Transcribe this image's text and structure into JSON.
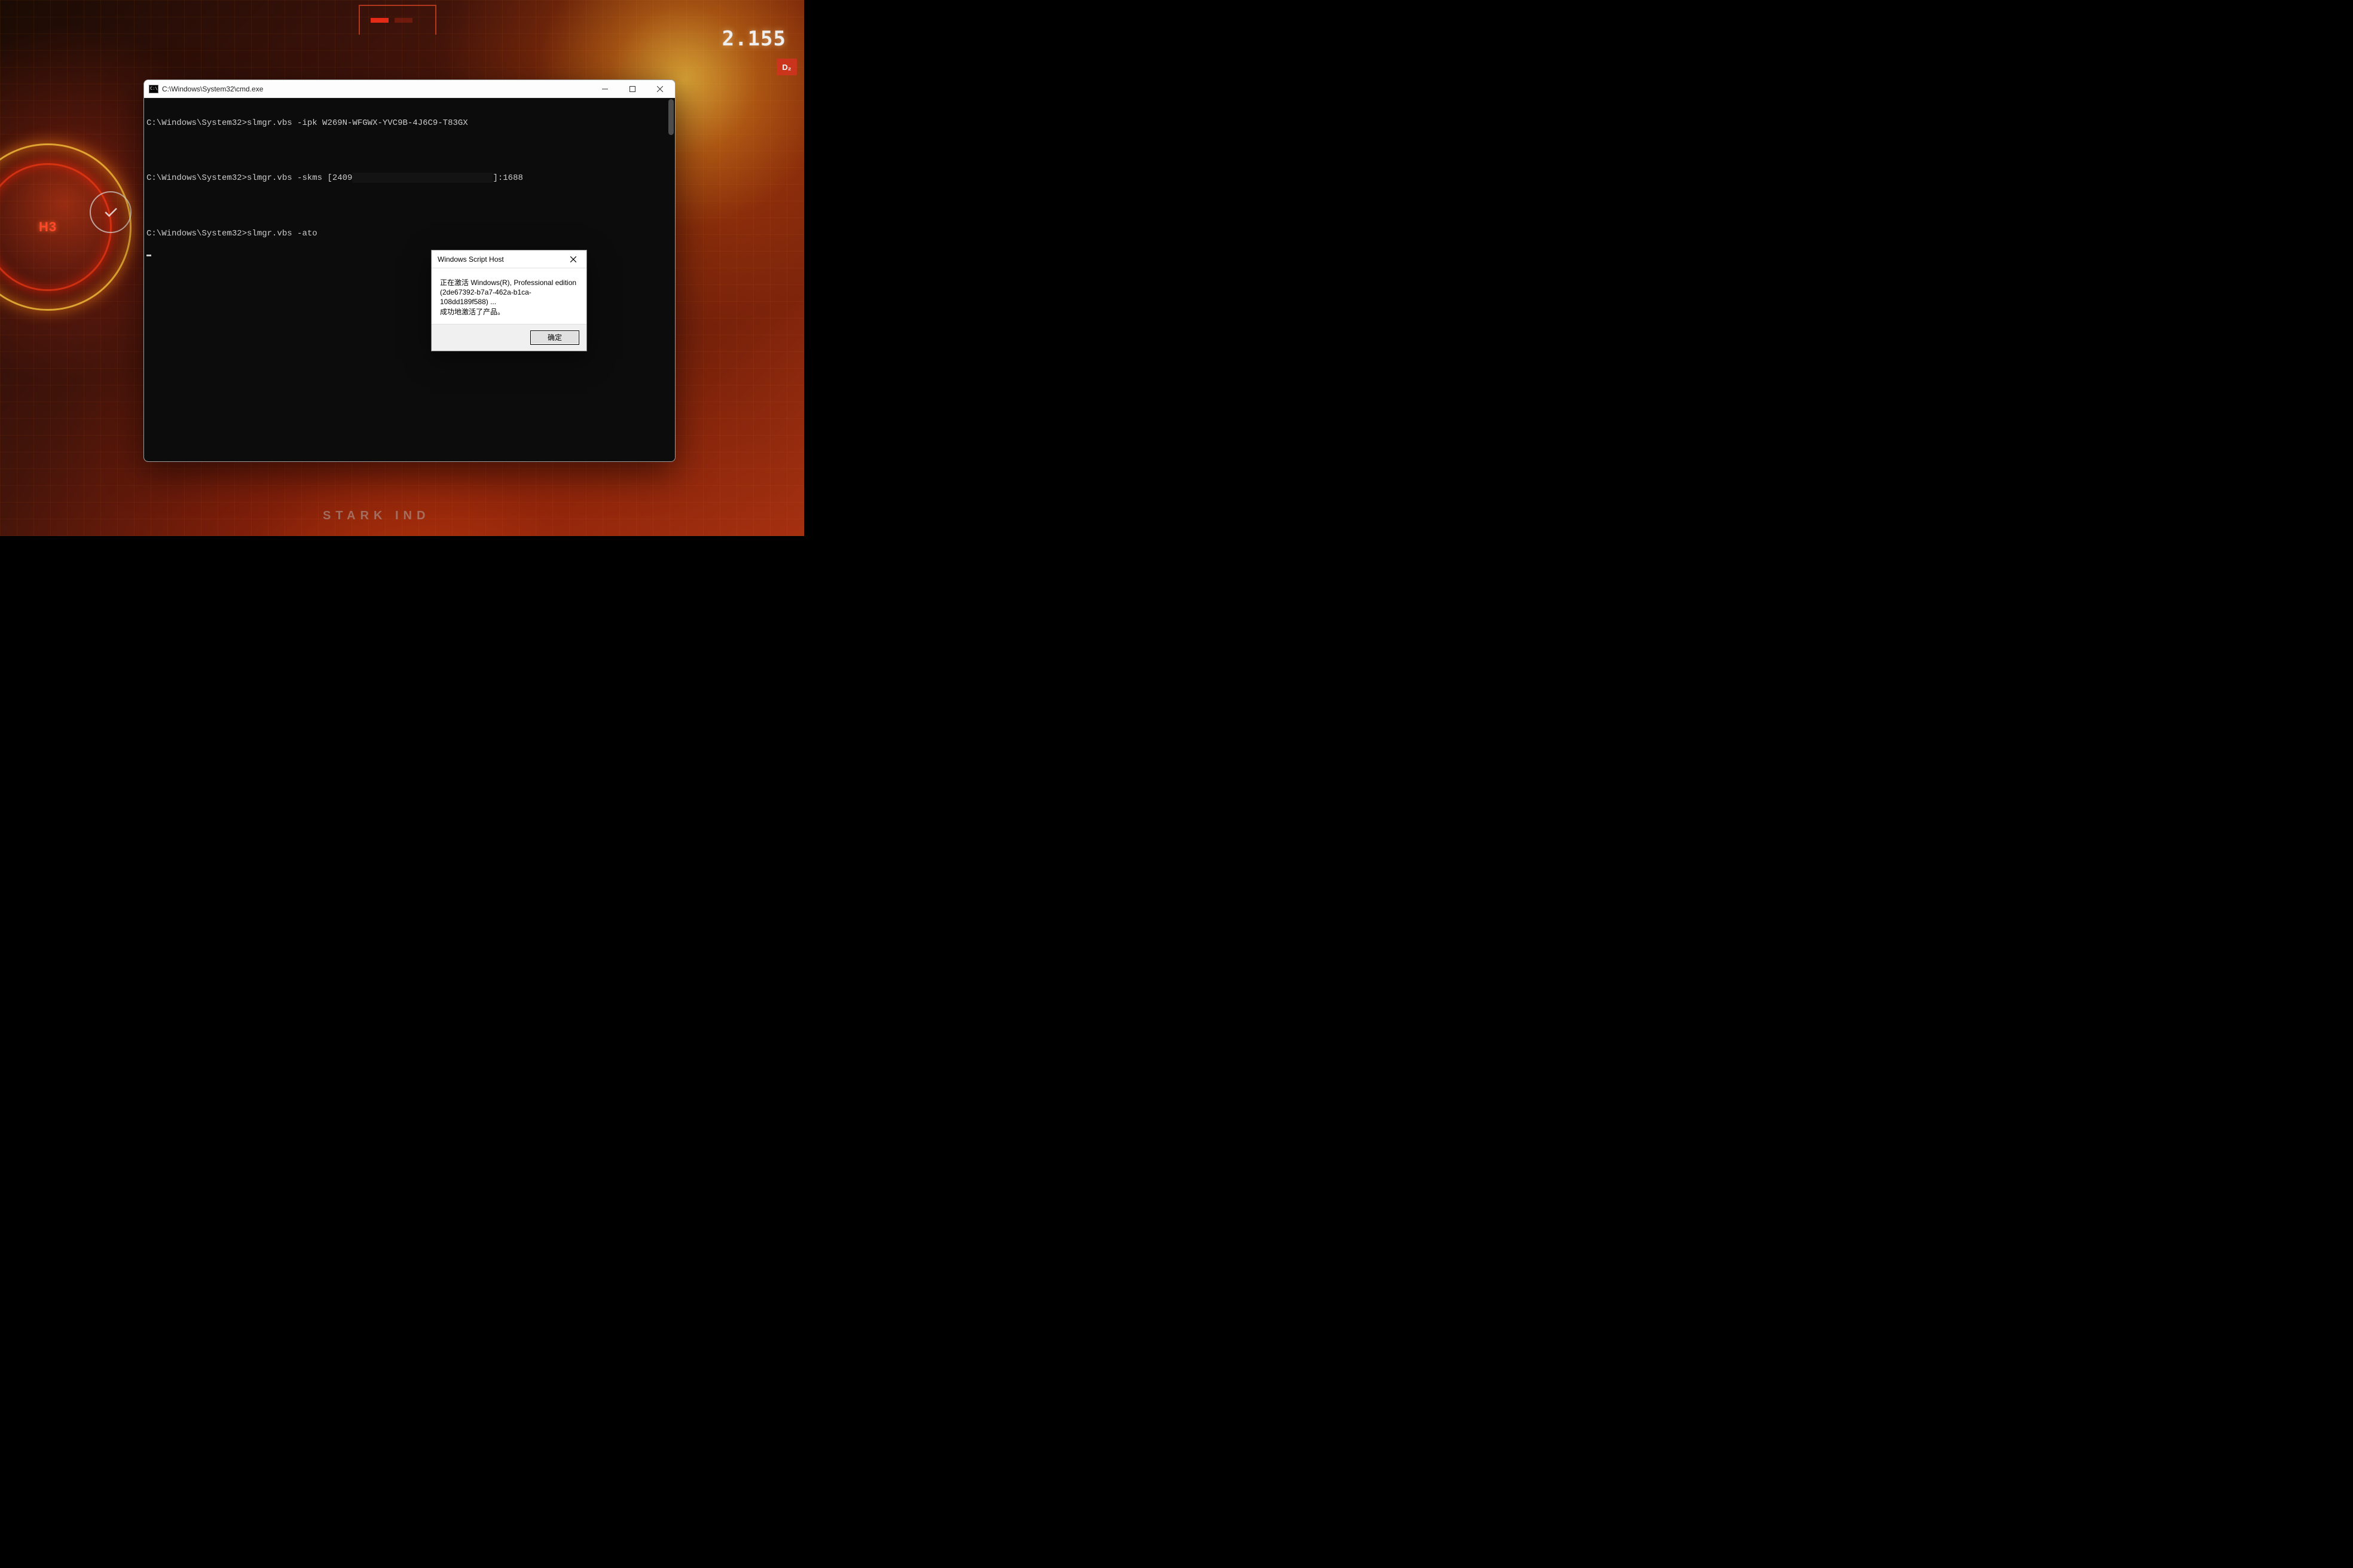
{
  "wallpaper": {
    "ring_label": "H3",
    "meter_value": "2.155",
    "badge": "D₂",
    "brand_hint": "STARK IND"
  },
  "cmd": {
    "title": "C:\\Windows\\System32\\cmd.exe",
    "prompt": "C:\\Windows\\System32>",
    "lines": {
      "l1_cmd": "slmgr.vbs -ipk W269N-WFGWX-YVC9B-4J6C9-T83GX",
      "l2_cmd_a": "slmgr.vbs -skms [2409",
      "l2_cmd_b": "]:1688",
      "l3_cmd": "slmgr.vbs -ato"
    }
  },
  "wsh": {
    "title": "Windows Script Host",
    "message_line1": "正在激活 Windows(R), Professional edition",
    "message_line2": "(2de67392-b7a7-462a-b1ca-108dd189f588) ...",
    "message_line3": "成功地激活了产品。",
    "ok_label": "确定"
  }
}
